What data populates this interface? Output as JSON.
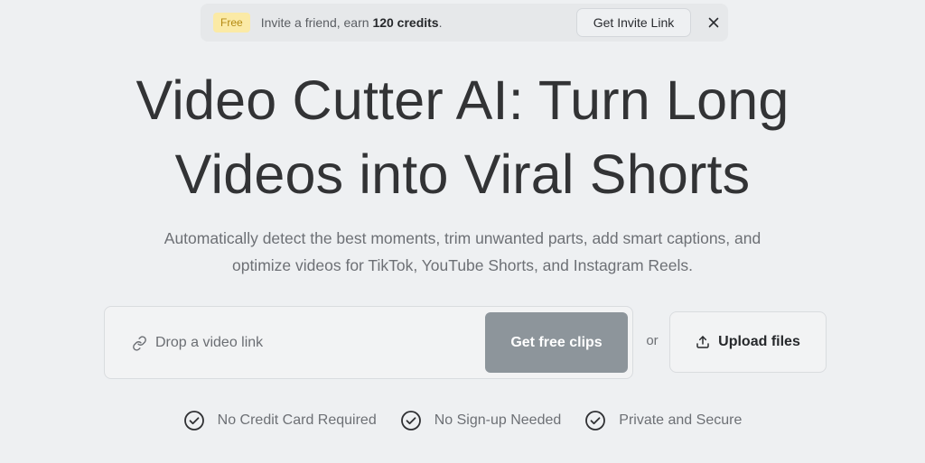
{
  "banner": {
    "badge": "Free",
    "text_prefix": "Invite a friend, earn ",
    "text_bold": "120 credits",
    "text_suffix": ".",
    "invite_button": "Get Invite Link",
    "close_icon": "close-icon"
  },
  "hero": {
    "title_line1": "Video Cutter AI: Turn Long",
    "title_line2": "Videos into Viral Shorts",
    "subtitle_line1": "Automatically detect the best moments, trim unwanted parts, add smart captions, and",
    "subtitle_line2": "optimize videos for TikTok, YouTube Shorts, and Instagram Reels."
  },
  "input": {
    "placeholder": "Drop a video link",
    "value": "",
    "icon": "link-icon",
    "submit_label": "Get free clips"
  },
  "or_label": "or",
  "upload": {
    "label": "Upload files",
    "icon": "upload-icon"
  },
  "features": [
    {
      "icon": "check-circle-icon",
      "label": "No Credit Card Required"
    },
    {
      "icon": "check-circle-icon",
      "label": "No Sign-up Needed"
    },
    {
      "icon": "check-circle-icon",
      "label": "Private and Secure"
    }
  ],
  "colors": {
    "background": "#eef0f2",
    "badge_bg": "#fbeaa6",
    "badge_text": "#b48a12",
    "primary_button": "#8d959b",
    "heading": "#323335",
    "muted_text": "#6d7075"
  }
}
